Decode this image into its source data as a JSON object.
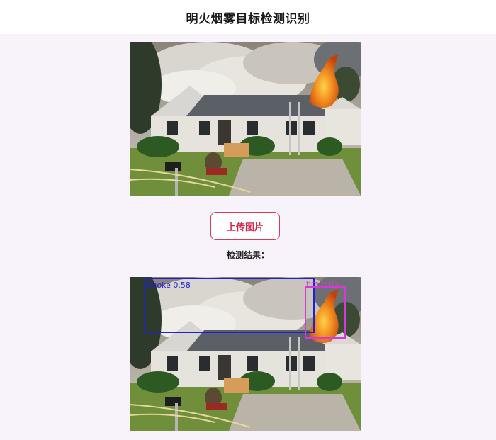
{
  "page": {
    "title": "明火烟雾目标检测识别"
  },
  "upload": {
    "label": "上传图片"
  },
  "result": {
    "label": "检测结果："
  },
  "images": {
    "original": {
      "description_alt": ""
    },
    "result": {
      "description_alt": ""
    }
  },
  "detections": [
    {
      "class": "smoke",
      "score": "0.58",
      "text": "smoke 0.58",
      "color": "#1f1fd6"
    },
    {
      "class": "fire",
      "score": "0.83",
      "text": "fire 0.83",
      "color": "#d63ad6"
    }
  ],
  "colors": {
    "accent": "#d0284e",
    "background": "#f8f3fb",
    "smoke_box": "#1f1fd6",
    "fire_box": "#d63ad6"
  }
}
